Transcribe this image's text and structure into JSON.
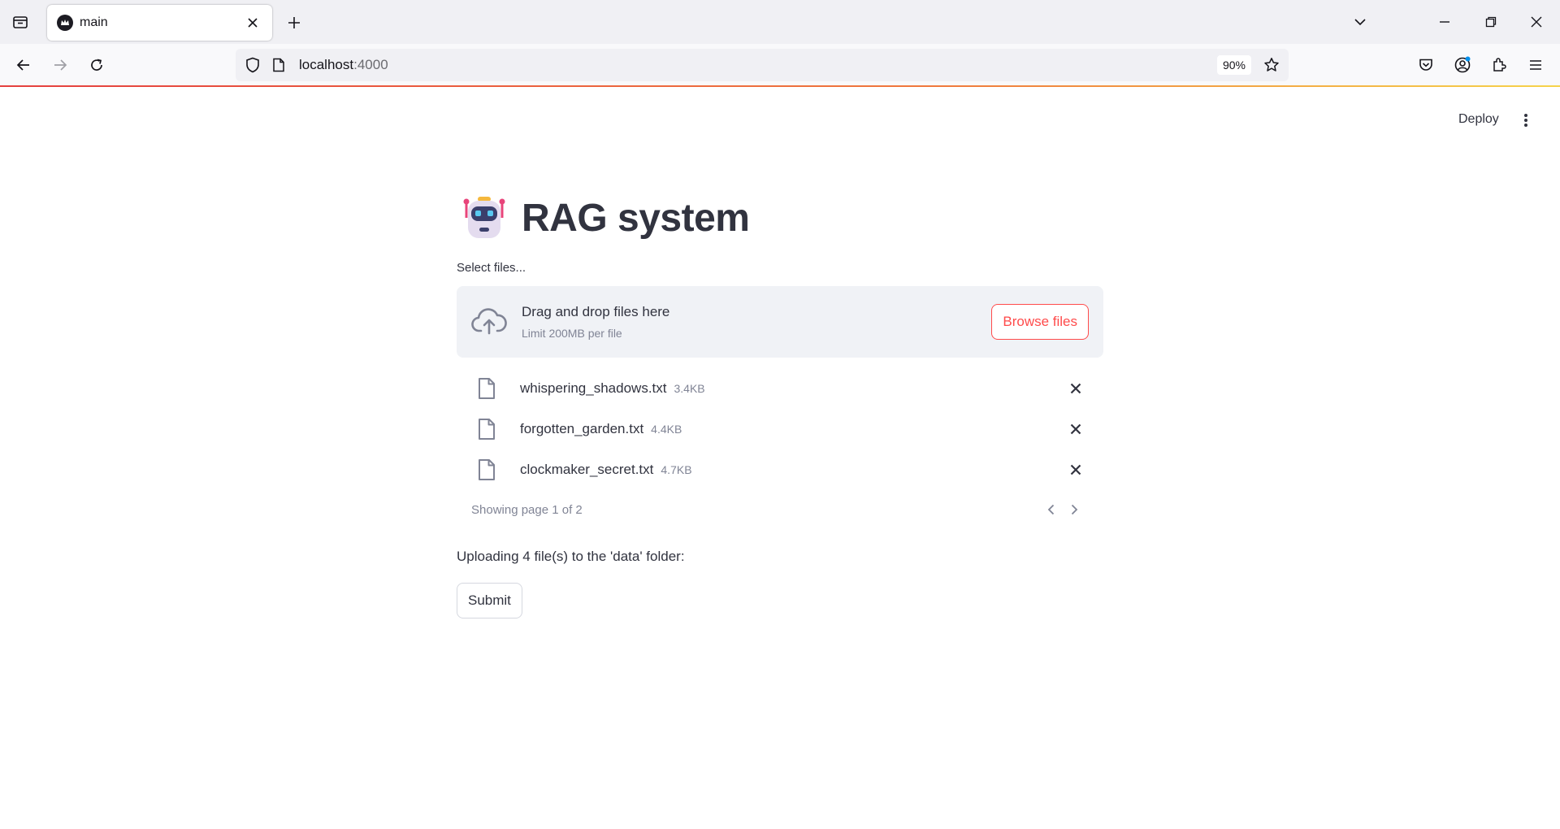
{
  "browser": {
    "tab_title": "main",
    "url_host": "localhost",
    "url_port": ":4000",
    "zoom": "90%"
  },
  "app": {
    "deploy_label": "Deploy",
    "title": "RAG system",
    "title_icon": "robot-emoji",
    "uploader": {
      "label": "Select files...",
      "drop_text": "Drag and drop files here",
      "limit_text": "Limit 200MB per file",
      "browse_label": "Browse files",
      "files": [
        {
          "name": "whispering_shadows.txt",
          "size": "3.4KB"
        },
        {
          "name": "forgotten_garden.txt",
          "size": "4.4KB"
        },
        {
          "name": "clockmaker_secret.txt",
          "size": "4.7KB"
        }
      ],
      "pagination": "Showing page 1 of 2"
    },
    "upload_message": "Uploading 4 file(s) to the 'data' folder:",
    "submit_label": "Submit"
  },
  "colors": {
    "accent": "#ff4b4b",
    "dropzone_bg": "#f0f2f6",
    "text": "#31333f",
    "muted": "#808495"
  }
}
